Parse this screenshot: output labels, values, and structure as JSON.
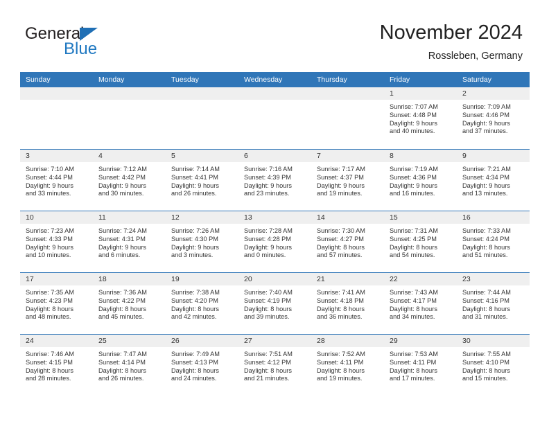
{
  "brand": {
    "name_dark": "General",
    "name_blue": "Blue",
    "accent_color": "#1f78c1",
    "header_color": "#3076b8"
  },
  "header": {
    "title": "November 2024",
    "subtitle": "Rossleben, Germany"
  },
  "calendar": {
    "weekday_headers": [
      "Sunday",
      "Monday",
      "Tuesday",
      "Wednesday",
      "Thursday",
      "Friday",
      "Saturday"
    ],
    "weeks": [
      [
        {
          "day": "",
          "empty": true
        },
        {
          "day": "",
          "empty": true
        },
        {
          "day": "",
          "empty": true
        },
        {
          "day": "",
          "empty": true
        },
        {
          "day": "",
          "empty": true
        },
        {
          "day": "1",
          "sunrise": "Sunrise: 7:07 AM",
          "sunset": "Sunset: 4:48 PM",
          "daylight1": "Daylight: 9 hours",
          "daylight2": "and 40 minutes."
        },
        {
          "day": "2",
          "sunrise": "Sunrise: 7:09 AM",
          "sunset": "Sunset: 4:46 PM",
          "daylight1": "Daylight: 9 hours",
          "daylight2": "and 37 minutes."
        }
      ],
      [
        {
          "day": "3",
          "sunrise": "Sunrise: 7:10 AM",
          "sunset": "Sunset: 4:44 PM",
          "daylight1": "Daylight: 9 hours",
          "daylight2": "and 33 minutes."
        },
        {
          "day": "4",
          "sunrise": "Sunrise: 7:12 AM",
          "sunset": "Sunset: 4:42 PM",
          "daylight1": "Daylight: 9 hours",
          "daylight2": "and 30 minutes."
        },
        {
          "day": "5",
          "sunrise": "Sunrise: 7:14 AM",
          "sunset": "Sunset: 4:41 PM",
          "daylight1": "Daylight: 9 hours",
          "daylight2": "and 26 minutes."
        },
        {
          "day": "6",
          "sunrise": "Sunrise: 7:16 AM",
          "sunset": "Sunset: 4:39 PM",
          "daylight1": "Daylight: 9 hours",
          "daylight2": "and 23 minutes."
        },
        {
          "day": "7",
          "sunrise": "Sunrise: 7:17 AM",
          "sunset": "Sunset: 4:37 PM",
          "daylight1": "Daylight: 9 hours",
          "daylight2": "and 19 minutes."
        },
        {
          "day": "8",
          "sunrise": "Sunrise: 7:19 AM",
          "sunset": "Sunset: 4:36 PM",
          "daylight1": "Daylight: 9 hours",
          "daylight2": "and 16 minutes."
        },
        {
          "day": "9",
          "sunrise": "Sunrise: 7:21 AM",
          "sunset": "Sunset: 4:34 PM",
          "daylight1": "Daylight: 9 hours",
          "daylight2": "and 13 minutes."
        }
      ],
      [
        {
          "day": "10",
          "sunrise": "Sunrise: 7:23 AM",
          "sunset": "Sunset: 4:33 PM",
          "daylight1": "Daylight: 9 hours",
          "daylight2": "and 10 minutes."
        },
        {
          "day": "11",
          "sunrise": "Sunrise: 7:24 AM",
          "sunset": "Sunset: 4:31 PM",
          "daylight1": "Daylight: 9 hours",
          "daylight2": "and 6 minutes."
        },
        {
          "day": "12",
          "sunrise": "Sunrise: 7:26 AM",
          "sunset": "Sunset: 4:30 PM",
          "daylight1": "Daylight: 9 hours",
          "daylight2": "and 3 minutes."
        },
        {
          "day": "13",
          "sunrise": "Sunrise: 7:28 AM",
          "sunset": "Sunset: 4:28 PM",
          "daylight1": "Daylight: 9 hours",
          "daylight2": "and 0 minutes."
        },
        {
          "day": "14",
          "sunrise": "Sunrise: 7:30 AM",
          "sunset": "Sunset: 4:27 PM",
          "daylight1": "Daylight: 8 hours",
          "daylight2": "and 57 minutes."
        },
        {
          "day": "15",
          "sunrise": "Sunrise: 7:31 AM",
          "sunset": "Sunset: 4:25 PM",
          "daylight1": "Daylight: 8 hours",
          "daylight2": "and 54 minutes."
        },
        {
          "day": "16",
          "sunrise": "Sunrise: 7:33 AM",
          "sunset": "Sunset: 4:24 PM",
          "daylight1": "Daylight: 8 hours",
          "daylight2": "and 51 minutes."
        }
      ],
      [
        {
          "day": "17",
          "sunrise": "Sunrise: 7:35 AM",
          "sunset": "Sunset: 4:23 PM",
          "daylight1": "Daylight: 8 hours",
          "daylight2": "and 48 minutes."
        },
        {
          "day": "18",
          "sunrise": "Sunrise: 7:36 AM",
          "sunset": "Sunset: 4:22 PM",
          "daylight1": "Daylight: 8 hours",
          "daylight2": "and 45 minutes."
        },
        {
          "day": "19",
          "sunrise": "Sunrise: 7:38 AM",
          "sunset": "Sunset: 4:20 PM",
          "daylight1": "Daylight: 8 hours",
          "daylight2": "and 42 minutes."
        },
        {
          "day": "20",
          "sunrise": "Sunrise: 7:40 AM",
          "sunset": "Sunset: 4:19 PM",
          "daylight1": "Daylight: 8 hours",
          "daylight2": "and 39 minutes."
        },
        {
          "day": "21",
          "sunrise": "Sunrise: 7:41 AM",
          "sunset": "Sunset: 4:18 PM",
          "daylight1": "Daylight: 8 hours",
          "daylight2": "and 36 minutes."
        },
        {
          "day": "22",
          "sunrise": "Sunrise: 7:43 AM",
          "sunset": "Sunset: 4:17 PM",
          "daylight1": "Daylight: 8 hours",
          "daylight2": "and 34 minutes."
        },
        {
          "day": "23",
          "sunrise": "Sunrise: 7:44 AM",
          "sunset": "Sunset: 4:16 PM",
          "daylight1": "Daylight: 8 hours",
          "daylight2": "and 31 minutes."
        }
      ],
      [
        {
          "day": "24",
          "sunrise": "Sunrise: 7:46 AM",
          "sunset": "Sunset: 4:15 PM",
          "daylight1": "Daylight: 8 hours",
          "daylight2": "and 28 minutes."
        },
        {
          "day": "25",
          "sunrise": "Sunrise: 7:47 AM",
          "sunset": "Sunset: 4:14 PM",
          "daylight1": "Daylight: 8 hours",
          "daylight2": "and 26 minutes."
        },
        {
          "day": "26",
          "sunrise": "Sunrise: 7:49 AM",
          "sunset": "Sunset: 4:13 PM",
          "daylight1": "Daylight: 8 hours",
          "daylight2": "and 24 minutes."
        },
        {
          "day": "27",
          "sunrise": "Sunrise: 7:51 AM",
          "sunset": "Sunset: 4:12 PM",
          "daylight1": "Daylight: 8 hours",
          "daylight2": "and 21 minutes."
        },
        {
          "day": "28",
          "sunrise": "Sunrise: 7:52 AM",
          "sunset": "Sunset: 4:11 PM",
          "daylight1": "Daylight: 8 hours",
          "daylight2": "and 19 minutes."
        },
        {
          "day": "29",
          "sunrise": "Sunrise: 7:53 AM",
          "sunset": "Sunset: 4:11 PM",
          "daylight1": "Daylight: 8 hours",
          "daylight2": "and 17 minutes."
        },
        {
          "day": "30",
          "sunrise": "Sunrise: 7:55 AM",
          "sunset": "Sunset: 4:10 PM",
          "daylight1": "Daylight: 8 hours",
          "daylight2": "and 15 minutes."
        }
      ]
    ]
  }
}
